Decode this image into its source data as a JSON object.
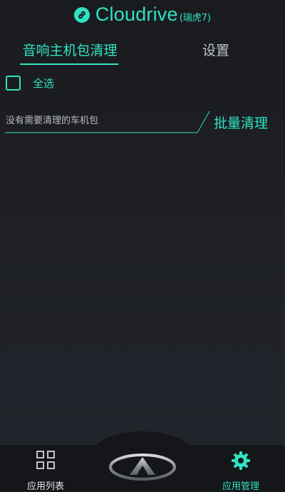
{
  "header": {
    "brand": "Cloudrive",
    "model": "(瑞虎7)",
    "logo_icon": "link-icon"
  },
  "tabs": [
    {
      "label": "音响主机包清理",
      "active": true
    },
    {
      "label": "设置",
      "active": false
    }
  ],
  "select_all": {
    "label": "全选",
    "checked": false
  },
  "empty_message": "没有需要清理的车机包",
  "batch_clean_label": "批量清理",
  "bottom_nav": [
    {
      "label": "应用列表",
      "icon": "grid-icon",
      "active": false
    },
    {
      "label": "",
      "icon": "chery-logo-icon",
      "active": false
    },
    {
      "label": "应用管理",
      "icon": "gear-icon",
      "active": true
    }
  ],
  "colors": {
    "accent": "#2fe3c2",
    "background": "#1d1f24",
    "nav_background": "#15161a",
    "text_primary": "#e6e6e6",
    "text_muted": "#b7bbc1"
  }
}
